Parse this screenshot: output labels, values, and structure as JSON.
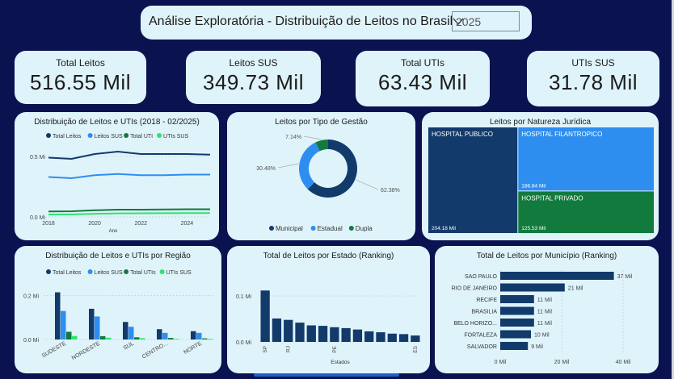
{
  "header": {
    "title": "Análise Exploratória - Distribuição de Leitos no Brasil",
    "year_selected": "2025"
  },
  "kpis": [
    {
      "label": "Total Leitos",
      "value": "516.55 Mil"
    },
    {
      "label": "Leitos SUS",
      "value": "349.73 Mil"
    },
    {
      "label": "Total UTIs",
      "value": "63.43 Mil"
    },
    {
      "label": "UTIs SUS",
      "value": "31.78 Mil"
    }
  ],
  "colors": {
    "total_leitos": "#123a6b",
    "leitos_sus": "#2e8ef0",
    "total_uti": "#117a3c",
    "uti_sus": "#2ee36e",
    "background": "#0a1250",
    "card": "#dff3fa"
  },
  "chart_data": [
    {
      "id": "line",
      "type": "line",
      "title": "Distribuição de Leitos e UTIs (2018 - 02/2025)",
      "xlabel": "Ano",
      "x": [
        2018,
        2019,
        2020,
        2021,
        2022,
        2023,
        2024,
        2025
      ],
      "xticks": [
        "2018",
        "2020",
        "2022",
        "2024"
      ],
      "yticks": [
        "0.0 Mi",
        "0.5 Mi"
      ],
      "ylim": [
        0,
        0.6
      ],
      "series": [
        {
          "name": "Total Leitos",
          "values": [
            0.49,
            0.48,
            0.52,
            0.54,
            0.52,
            0.52,
            0.52,
            0.515
          ]
        },
        {
          "name": "Leitos SUS",
          "values": [
            0.33,
            0.32,
            0.345,
            0.355,
            0.345,
            0.345,
            0.35,
            0.35
          ]
        },
        {
          "name": "Total UTI",
          "values": [
            0.045,
            0.047,
            0.055,
            0.06,
            0.06,
            0.062,
            0.063,
            0.063
          ]
        },
        {
          "name": "UTIs SUS",
          "values": [
            0.02,
            0.021,
            0.026,
            0.029,
            0.03,
            0.031,
            0.032,
            0.032
          ]
        }
      ],
      "legend": "top"
    },
    {
      "id": "donut",
      "type": "pie",
      "title": "Leitos por Tipo de Gestão",
      "slices": [
        {
          "name": "Municipal",
          "value": 62.38,
          "label": "62.38%"
        },
        {
          "name": "Estadual",
          "value": 30.48,
          "label": "30.48%"
        },
        {
          "name": "Dupla",
          "value": 7.14,
          "label": "7.14%"
        }
      ],
      "legend": "bottom"
    },
    {
      "id": "treemap",
      "type": "treemap",
      "title": "Leitos por Natureza Jurídica",
      "items": [
        {
          "name": "HOSPITAL PUBLICO",
          "value": 204.18,
          "label": "204.18 Mil"
        },
        {
          "name": "HOSPITAL FILANTROPICO",
          "value": 186.84,
          "label": "186.84 Mil"
        },
        {
          "name": "HOSPITAL PRIVADO",
          "value": 125.53,
          "label": "125.53 Mil"
        }
      ]
    },
    {
      "id": "region",
      "type": "bar",
      "title": "Distribuição de Leitos e UTIs por Região",
      "categories": [
        "SUDESTE",
        "NORDESTE",
        "SUL",
        "CENTRO...",
        "NORTE"
      ],
      "series": [
        {
          "name": "Total Leitos",
          "values": [
            0.215,
            0.14,
            0.08,
            0.047,
            0.038
          ]
        },
        {
          "name": "Leitos SUS",
          "values": [
            0.13,
            0.105,
            0.058,
            0.03,
            0.03
          ]
        },
        {
          "name": "Total UTIs",
          "values": [
            0.035,
            0.015,
            0.01,
            0.007,
            0.005
          ]
        },
        {
          "name": "UTIs SUS",
          "values": [
            0.016,
            0.008,
            0.006,
            0.003,
            0.003
          ]
        }
      ],
      "yticks": [
        "0.0 Mi",
        "0.2 Mi"
      ],
      "ylim": [
        0,
        0.25
      ],
      "legend": "top"
    },
    {
      "id": "state",
      "type": "bar",
      "title": "Total de Leitos por Estado (Ranking)",
      "xlabel": "Estados",
      "xticks": [
        "SP",
        "RJ",
        "PE",
        "ES"
      ],
      "values": [
        0.112,
        0.051,
        0.048,
        0.042,
        0.036,
        0.035,
        0.032,
        0.03,
        0.027,
        0.023,
        0.021,
        0.018,
        0.017,
        0.014
      ],
      "yticks": [
        "0.0 Mi",
        "0.1 Mi"
      ],
      "ylim": [
        0,
        0.13
      ]
    },
    {
      "id": "municipio",
      "type": "bar",
      "title": "Total de Leitos por Município (Ranking)",
      "categories": [
        "SAO PAULO",
        "RIO DE JANEIRO",
        "RECIFE",
        "BRASILIA",
        "BELO HORIZO...",
        "FORTALEZA",
        "SALVADOR"
      ],
      "values": [
        37,
        21,
        11,
        11,
        11,
        10,
        9
      ],
      "labels": [
        "37 Mil",
        "21 Mil",
        "11 Mil",
        "11 Mil",
        "11 Mil",
        "10 Mil",
        "9 Mil"
      ],
      "xticks": [
        "0 Mil",
        "20 Mil",
        "40 Mil"
      ],
      "xlim": [
        0,
        40
      ]
    }
  ]
}
